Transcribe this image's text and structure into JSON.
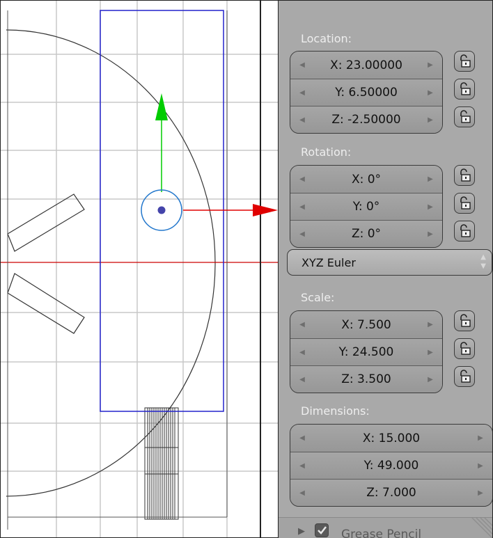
{
  "viewport": {
    "colors": {
      "grid": "#c8c8c8",
      "wire": "#333333",
      "selected": "#2a2ad0",
      "x_axis": "#e00000",
      "y_axis": "#00cc00",
      "pivot": "#2277cc"
    }
  },
  "transform": {
    "location": {
      "label": "Location:",
      "fields": [
        {
          "value": "X: 23.00000",
          "locked": false
        },
        {
          "value": "Y: 6.50000",
          "locked": false
        },
        {
          "value": "Z: -2.50000",
          "locked": false
        }
      ]
    },
    "rotation": {
      "label": "Rotation:",
      "fields": [
        {
          "value": "X: 0°",
          "locked": false
        },
        {
          "value": "Y: 0°",
          "locked": false
        },
        {
          "value": "Z: 0°",
          "locked": false
        }
      ],
      "mode": "XYZ Euler"
    },
    "scale": {
      "label": "Scale:",
      "fields": [
        {
          "value": "X: 7.500",
          "locked": false
        },
        {
          "value": "Y: 24.500",
          "locked": false
        },
        {
          "value": "Z: 3.500",
          "locked": false
        }
      ]
    },
    "dimensions": {
      "label": "Dimensions:",
      "fields": [
        {
          "value": "X: 15.000"
        },
        {
          "value": "Y: 49.000"
        },
        {
          "value": "Z: 7.000"
        }
      ]
    }
  },
  "footer": {
    "label": "Grease Pencil",
    "checked": true
  }
}
